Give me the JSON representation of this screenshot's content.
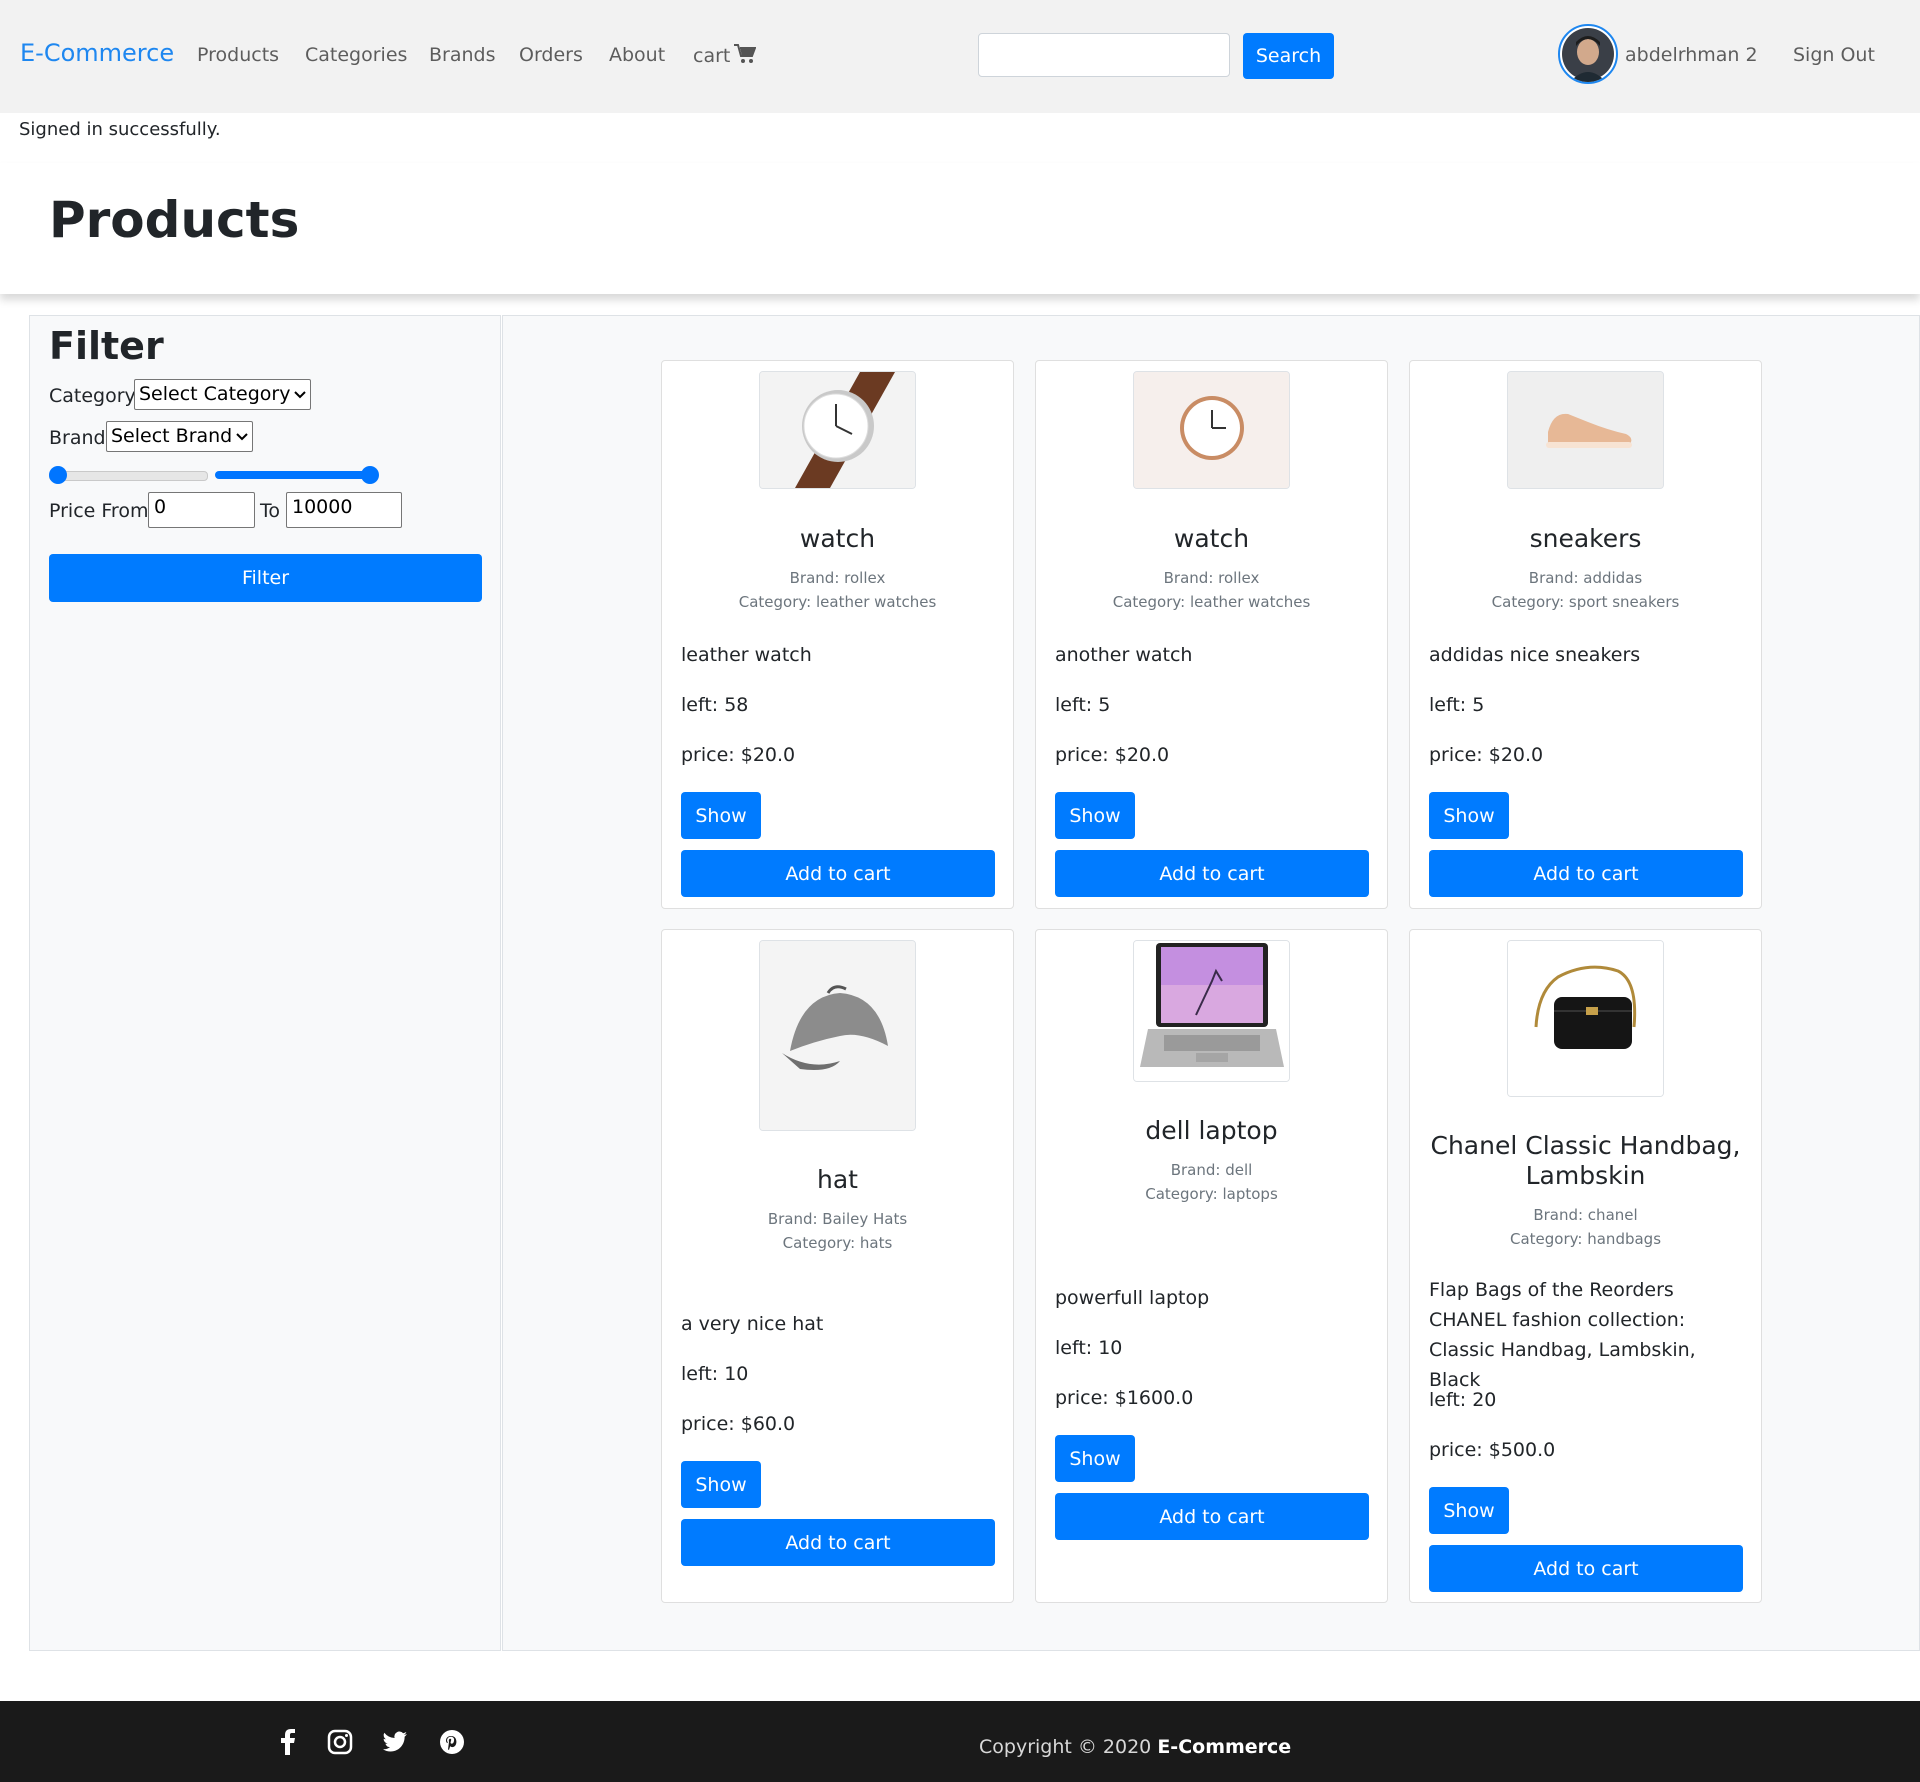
{
  "nav": {
    "brand": "E-Commerce",
    "links": [
      "Products",
      "Categories",
      "Brands",
      "Orders",
      "About"
    ],
    "cart_label": "cart",
    "search_placeholder": "",
    "search_button": "Search",
    "username": "abdelrhman 2",
    "sign_out": "Sign Out"
  },
  "flash": "Signed in successfully.",
  "page_title": "Products",
  "filter": {
    "title": "Filter",
    "category_label": "Category",
    "category_value": "Select Category",
    "brand_label": "Brand",
    "brand_value": "Select Brand",
    "price_from_label": "Price From",
    "price_from_value": "0",
    "price_to_label": "To",
    "price_to_value": "10000",
    "button": "Filter"
  },
  "products": [
    {
      "name": "watch",
      "brand": "Brand: rollex",
      "category": "Category: leather watches",
      "description": "leather watch",
      "left": "left: 58",
      "price": "price: $20.0",
      "image": "watch-leather"
    },
    {
      "name": "watch",
      "brand": "Brand: rollex",
      "category": "Category: leather watches",
      "description": "another watch",
      "left": "left: 5",
      "price": "price: $20.0",
      "image": "wall-clock"
    },
    {
      "name": "sneakers",
      "brand": "Brand: addidas",
      "category": "Category: sport sneakers",
      "description": "addidas nice sneakers",
      "left": "left: 5",
      "price": "price: $20.0",
      "image": "sneaker"
    },
    {
      "name": "hat",
      "brand": "Brand: Bailey Hats",
      "category": "Category: hats",
      "description": "a very nice hat",
      "left": "left: 10",
      "price": "price: $60.0",
      "image": "hat"
    },
    {
      "name": "dell laptop",
      "brand": "Brand: dell",
      "category": "Category: laptops",
      "description": "powerfull laptop",
      "left": "left: 10",
      "price": "price: $1600.0",
      "image": "laptop"
    },
    {
      "name": "Chanel Classic Handbag, Lambskin",
      "brand": "Brand: chanel",
      "category": "Category: handbags",
      "description": "Flap Bags of the Reorders CHANEL fashion collection: Classic Handbag, Lambskin, Black",
      "left": "left: 20",
      "price": "price: $500.0",
      "image": "handbag"
    }
  ],
  "buttons": {
    "show": "Show",
    "add_to_cart": "Add to cart"
  },
  "footer": {
    "social_icons": [
      "facebook-icon",
      "instagram-icon",
      "twitter-icon",
      "pinterest-icon"
    ],
    "copyright_prefix": "Copyright © 2020",
    "copyright_brand": "E-Commerce"
  },
  "colors": {
    "primary": "#007bff",
    "brand": "#1e87f0",
    "footer": "#1a1a1a"
  }
}
